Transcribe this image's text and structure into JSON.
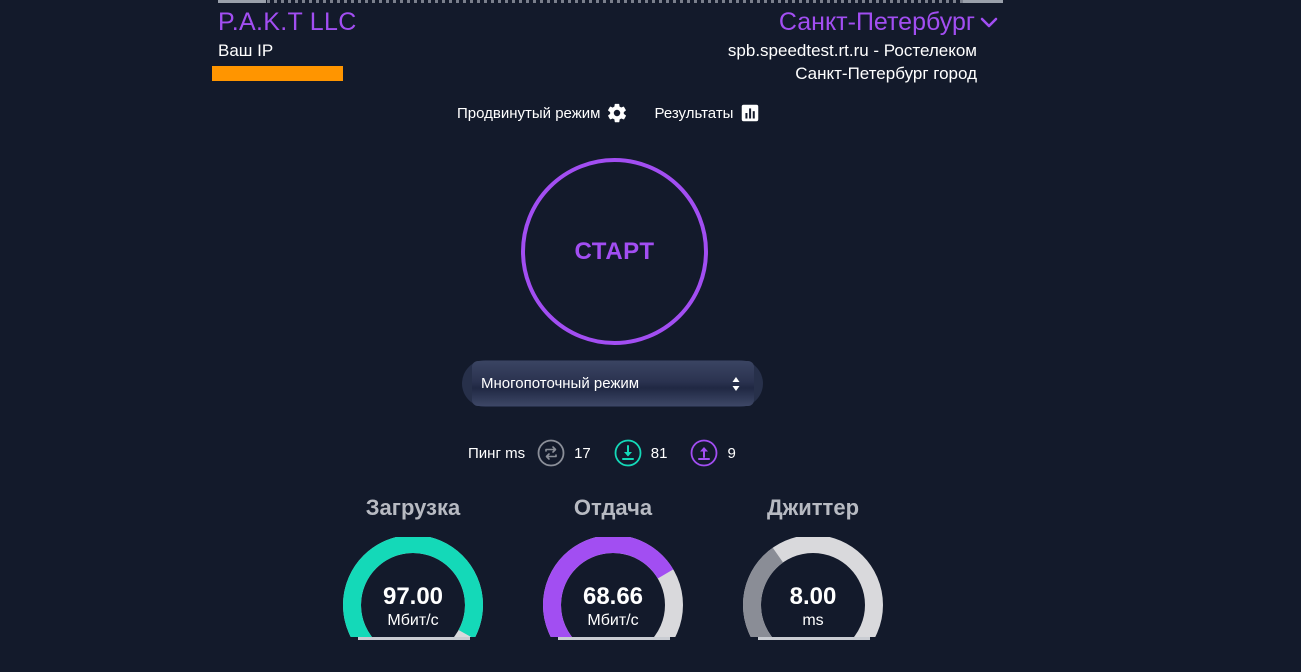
{
  "header": {
    "provider": "P.A.K.T LLC",
    "ip_label": "Ваш IP",
    "ip_bar_color": "#ff9500",
    "city": "Санкт-Петербург",
    "server": "spb.speedtest.rt.ru - Ростелеком",
    "server_location": "Санкт-Петербург город"
  },
  "toolbar": {
    "advanced_mode": "Продвинутый режим",
    "advanced_icon": "gear-icon",
    "results": "Результаты",
    "results_icon": "bar-chart-icon"
  },
  "start": {
    "label": "СТАРТ"
  },
  "mode_select": {
    "selected": "Многопоточный режим"
  },
  "ping": {
    "label": "Пинг ms",
    "idle": "17",
    "download": "81",
    "upload": "9"
  },
  "gauges": [
    {
      "title": "Загрузка",
      "value": "97.00",
      "unit": "Мбит/с",
      "fill_fraction": 0.94,
      "color": "#14d9b8"
    },
    {
      "title": "Отдача",
      "value": "68.66",
      "unit": "Мбит/с",
      "fill_fraction": 0.72,
      "color": "#a24ef2"
    },
    {
      "title": "Джиттер",
      "value": "8.00",
      "unit": "ms",
      "fill_fraction": 0.37,
      "color": "#8a8d96"
    }
  ],
  "colors": {
    "background": "#131a2b",
    "accent": "#a24ef2",
    "teal": "#14d9b8",
    "track": "#d9d9dc"
  }
}
